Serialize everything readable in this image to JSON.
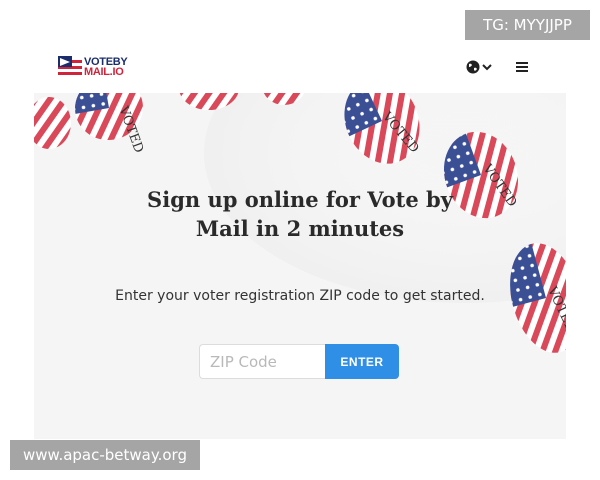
{
  "watermark": {
    "top": "TG: MYYJJPP",
    "bottom": "www.apac-betway.org"
  },
  "navbar": {
    "logo": {
      "line1": "VOTEBY",
      "line2": "MAIL.IO"
    },
    "language_icon": "globe-icon",
    "language_caret": "chevron-down-icon",
    "menu_icon": "hamburger-menu-icon"
  },
  "hero": {
    "title": "Sign up online for Vote by Mail in 2 minutes",
    "subtitle": "Enter your voter registration ZIP code to get started.",
    "stickers_text": "VOTED"
  },
  "form": {
    "zip_placeholder": "ZIP Code",
    "zip_value": "",
    "enter_label": "ENTER"
  },
  "colors": {
    "brand_blue": "#1b2d6b",
    "brand_red": "#d0243c",
    "button_blue": "#2f8ee6",
    "hero_bg": "#f4f4f4"
  }
}
